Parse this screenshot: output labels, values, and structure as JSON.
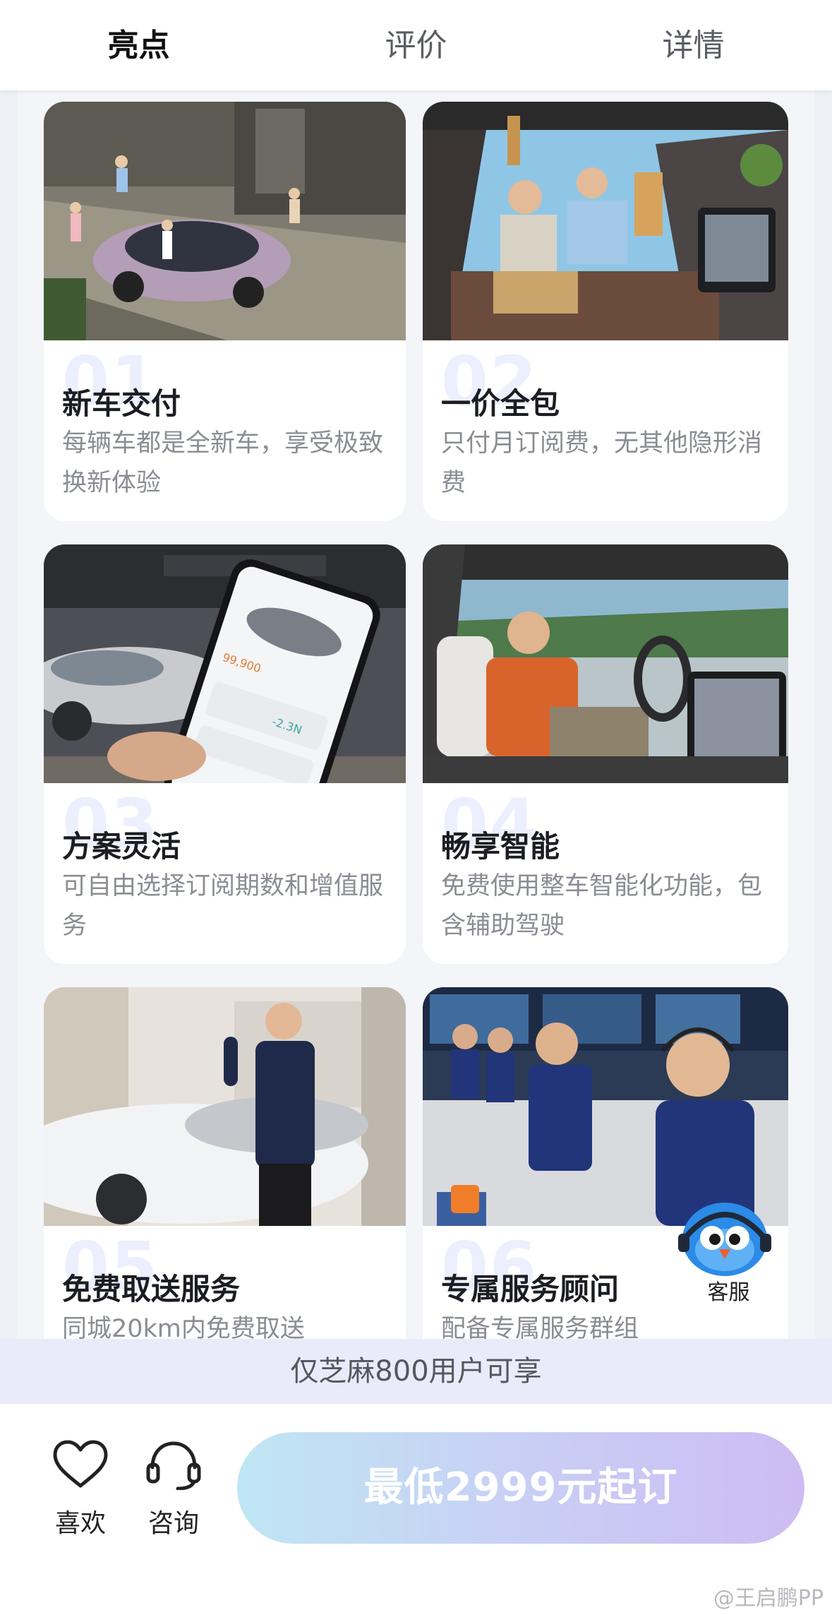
{
  "tabs": [
    {
      "label": "亮点",
      "active": true
    },
    {
      "label": "评价",
      "active": false
    },
    {
      "label": "详情",
      "active": false
    }
  ],
  "cards": [
    {
      "num": "01",
      "title": "新车交付",
      "desc": "每辆车都是全新车，享受极致换新体验"
    },
    {
      "num": "02",
      "title": "一价全包",
      "desc": "只付月订阅费，无其他隐形消费"
    },
    {
      "num": "03",
      "title": "方案灵活",
      "desc": "可自由选择订阅期数和增值服务"
    },
    {
      "num": "04",
      "title": "畅享智能",
      "desc": "免费使用整车智能化功能，包含辅助驾驶"
    },
    {
      "num": "05",
      "title": "免费取送服务",
      "desc": "同城20km内免费取送"
    },
    {
      "num": "06",
      "title": "专属服务顾问",
      "desc": "配备专属服务群组"
    }
  ],
  "phone_mock": {
    "price": "99,900",
    "range": "-2.3N"
  },
  "customer_service": {
    "label": "客服",
    "icon": "bird-mascot-icon"
  },
  "notice": "仅芝麻800用户可享",
  "bottom": {
    "like_label": "喜欢",
    "consult_label": "咨询",
    "cta_label": "最低2999元起订"
  },
  "watermark": "@王启鹏PP",
  "colors": {
    "accent_gradient_start": "#bfe6f4",
    "accent_gradient_end": "#cdbcf3",
    "notice_bg": "#e9ebfb"
  }
}
